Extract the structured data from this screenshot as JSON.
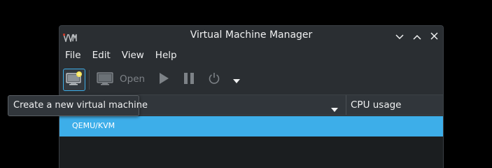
{
  "window": {
    "title": "Virtual Machine Manager",
    "app_icon": "virt-manager-logo-icon",
    "controls": [
      "minimize-icon",
      "maximize-icon",
      "close-icon"
    ]
  },
  "menu": {
    "items": [
      {
        "label": "File"
      },
      {
        "label": "Edit"
      },
      {
        "label": "View"
      },
      {
        "label": "Help"
      }
    ]
  },
  "toolbar": {
    "new_vm_icon": "new-vm-icon",
    "open_label": "Open",
    "open_icon": "monitor-icon",
    "run_icon": "play-icon",
    "pause_icon": "pause-icon",
    "shutdown_icon": "power-icon",
    "more_icon": "dropdown-arrow-icon"
  },
  "list": {
    "columns": [
      {
        "label": ""
      },
      {
        "label": "CPU usage"
      }
    ],
    "rows": [
      {
        "name": "QEMU/KVM",
        "selected": true
      }
    ]
  },
  "tooltip": {
    "text": "Create a new virtual machine"
  },
  "colors": {
    "accent": "#3daee9",
    "window_bg": "#2a2e32",
    "list_bg": "#1b1e20",
    "text": "#eff0f1",
    "disabled_text": "#7d8287"
  }
}
